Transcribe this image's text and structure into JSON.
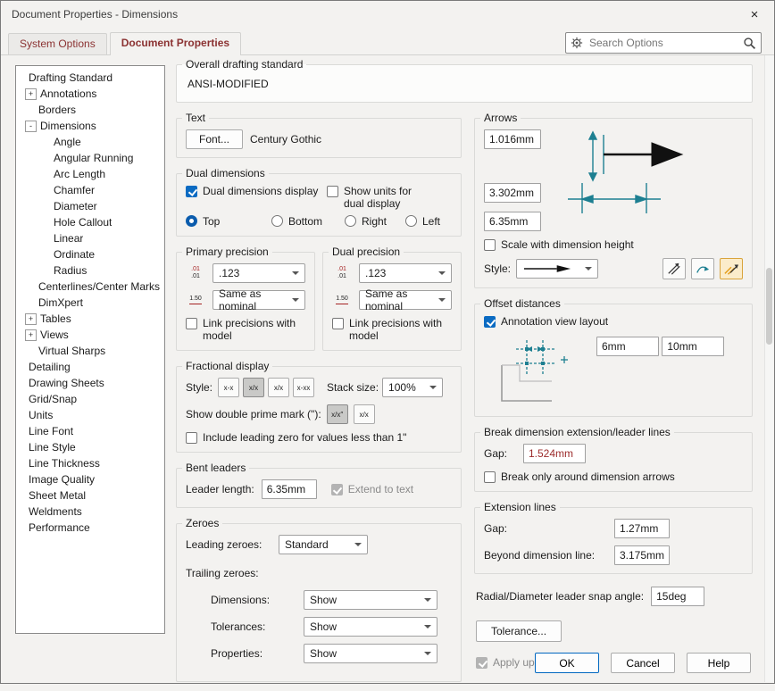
{
  "colors": {
    "accent": "#0067c0",
    "tab_text": "#8b3232",
    "diagram_teal": "#1d7f91"
  },
  "window": {
    "title": "Document Properties - Dimensions"
  },
  "icons": {
    "plus": "+",
    "minus": "-",
    "close": "×",
    "frac1": "x-x",
    "frac2": "x/x",
    "frac3": "x/x",
    "frac4": "x-xx",
    "dp1": "x/x″",
    "dp2": "x/x",
    "prec_top": ".01",
    "prec_bottom": ".01",
    "prec_nom": "1.50"
  },
  "tabs": {
    "system_options": "System Options",
    "document_properties": "Document Properties"
  },
  "search": {
    "placeholder": "Search Options"
  },
  "tree": {
    "items": [
      "Drafting Standard",
      "Annotations",
      "Borders",
      "Dimensions",
      "Angle",
      "Angular Running",
      "Arc Length",
      "Chamfer",
      "Diameter",
      "Hole Callout",
      "Linear",
      "Ordinate",
      "Radius",
      "Centerlines/Center Marks",
      "DimXpert",
      "Tables",
      "Views",
      "Virtual Sharps",
      "Detailing",
      "Drawing Sheets",
      "Grid/Snap",
      "Units",
      "Line Font",
      "Line Style",
      "Line Thickness",
      "Image Quality",
      "Sheet Metal",
      "Weldments",
      "Performance"
    ]
  },
  "overall": {
    "label": "Overall drafting standard",
    "value": "ANSI-MODIFIED"
  },
  "text_group": {
    "label": "Text",
    "font_button": "Font...",
    "font_name": "Century Gothic"
  },
  "dual_dimensions": {
    "label": "Dual dimensions",
    "display": "Dual dimensions display",
    "show_units": "Show units for dual display",
    "top": "Top",
    "bottom": "Bottom",
    "right": "Right",
    "left": "Left"
  },
  "primary_precision": {
    "label": "Primary precision",
    "value": ".123",
    "tolerance": "Same as nominal",
    "link": "Link precisions with model"
  },
  "dual_precision": {
    "label": "Dual precision",
    "value": ".123",
    "tolerance": "Same as nominal",
    "link": "Link precisions with model"
  },
  "fractional": {
    "label": "Fractional display",
    "style_label": "Style:",
    "stack_label": "Stack size:",
    "stack_value": "100%",
    "double_prime": "Show double prime mark (\"):",
    "leading_zero": "Include leading zero for values less than 1\""
  },
  "bent_leaders": {
    "label": "Bent leaders",
    "length_label": "Leader length:",
    "length_value": "6.35mm",
    "extend": "Extend to text"
  },
  "zeroes": {
    "label": "Zeroes",
    "leading_label": "Leading zeroes:",
    "leading_value": "Standard",
    "trailing_label": "Trailing zeroes:",
    "dimensions_label": "Dimensions:",
    "dimensions_value": "Show",
    "tolerances_label": "Tolerances:",
    "tolerances_value": "Show",
    "properties_label": "Properties:",
    "properties_value": "Show"
  },
  "arrows": {
    "label": "Arrows",
    "size1": "1.016mm",
    "size2": "3.302mm",
    "size3": "6.35mm",
    "scale": "Scale with dimension height",
    "style_label": "Style:"
  },
  "offset": {
    "label": "Offset distances",
    "annotation": "Annotation view layout",
    "v1": "6mm",
    "v2": "10mm"
  },
  "break_lines": {
    "label": "Break dimension extension/leader lines",
    "gap_label": "Gap:",
    "gap_value": "1.524mm",
    "only_arrows": "Break only around dimension arrows"
  },
  "extension": {
    "label": "Extension lines",
    "gap_label": "Gap:",
    "gap_value": "1.27mm",
    "beyond_label": "Beyond dimension line:",
    "beyond_value": "3.175mm"
  },
  "radial": {
    "label": "Radial/Diameter leader snap angle:",
    "value": "15deg"
  },
  "tolerance_button": "Tolerance...",
  "apply_rules": "Apply updated rules",
  "footer": {
    "ok": "OK",
    "cancel": "Cancel",
    "help": "Help"
  }
}
